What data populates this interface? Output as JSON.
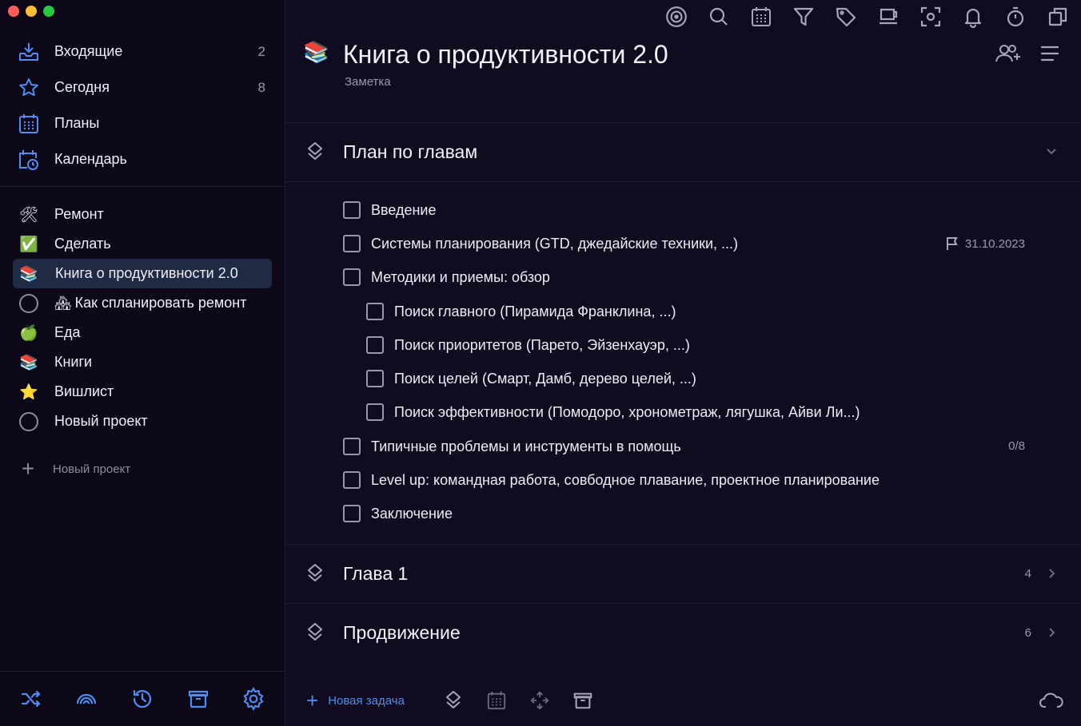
{
  "colors": {
    "accent": "#4d8ef0",
    "icon_gray": "#a9a4b6",
    "active_bg": "#1f2a45",
    "bg": "#100b1f"
  },
  "nav": {
    "items": [
      {
        "label": "Входящие",
        "count": "2",
        "icon": "inbox-icon"
      },
      {
        "label": "Сегодня",
        "count": "8",
        "icon": "star-icon"
      },
      {
        "label": "Планы",
        "count": "",
        "icon": "calendar-grid-icon"
      },
      {
        "label": "Календарь",
        "count": "",
        "icon": "calendar-clock-icon"
      }
    ]
  },
  "projects": {
    "items": [
      {
        "label": "Ремонт",
        "icon": "🛠"
      },
      {
        "label": "Сделать",
        "icon": "✅"
      },
      {
        "label": "Книга о продуктивности 2.0",
        "icon": "📚",
        "active": true
      },
      {
        "label": "Как спланировать ремонт",
        "icon": "🏘",
        "ring": true
      },
      {
        "label": "Еда",
        "icon": "🍏"
      },
      {
        "label": "Книги",
        "icon": "📚"
      },
      {
        "label": "Вишлист",
        "icon": "⭐"
      },
      {
        "label": "Новый проект",
        "icon": "",
        "ring": true
      }
    ],
    "new_label": "Новый проект"
  },
  "header": {
    "emoji": "📚",
    "title": "Книга о продуктивности 2.0",
    "subtitle": "Заметка"
  },
  "sections": [
    {
      "title": "План по главам",
      "count": "",
      "expanded": true
    },
    {
      "title": "Глава 1",
      "count": "4",
      "expanded": false
    },
    {
      "title": "Продвижение",
      "count": "6",
      "expanded": false
    }
  ],
  "tasks": [
    {
      "text": "Введение",
      "level": 0,
      "meta": ""
    },
    {
      "text": "Системы планирования (GTD, джедайские техники, ...)",
      "level": 0,
      "meta": "31.10.2023",
      "flag": true
    },
    {
      "text": "Методики и приемы: обзор",
      "level": 0,
      "meta": ""
    },
    {
      "text": "Поиск главного (Пирамида Франклина, ...)",
      "level": 1,
      "meta": ""
    },
    {
      "text": "Поиск приоритетов (Парето, Эйзенхауэр, ...)",
      "level": 1,
      "meta": ""
    },
    {
      "text": "Поиск целей (Смарт, Дамб, дерево целей, ...)",
      "level": 1,
      "meta": ""
    },
    {
      "text": "Поиск эффективности (Помодоро, хронометраж, лягушка, Айви Ли...)",
      "level": 1,
      "meta": ""
    },
    {
      "text": "Типичные проблемы и инструменты в помощь",
      "level": 0,
      "meta": "0/8"
    },
    {
      "text": "Level up: командная работа, совбодное плавание, проектное планирование",
      "level": 0,
      "meta": ""
    },
    {
      "text": "Заключение",
      "level": 0,
      "meta": ""
    }
  ],
  "footer": {
    "new_task_label": "Новая задача"
  }
}
